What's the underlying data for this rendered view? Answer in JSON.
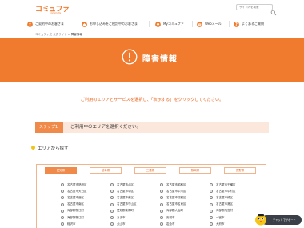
{
  "header": {
    "logo_main": "コミュファ",
    "logo_sub": "commufa",
    "search_placeholder": "サイト内を検索"
  },
  "nav": {
    "items": [
      {
        "label": "ご契約中のお客さま",
        "icon": "user-icon"
      },
      {
        "label": "お申し込みをご検討中のお客さま",
        "icon": "house-icon"
      },
      {
        "label": "Myコミュファ",
        "icon": "heart-icon"
      },
      {
        "label": "Webメール",
        "icon": "mail-icon"
      },
      {
        "label": "よくあるご質問",
        "icon": "question-icon"
      }
    ]
  },
  "breadcrumb": {
    "home": "コミュファ光 公式サイト",
    "separator": ">",
    "current": "障害情報"
  },
  "banner": {
    "title": "障害情報",
    "icon": "exclamation-circle-icon"
  },
  "instruction": "ご利用のエリアとサービスを選択し、「表示する」をクリックしてください。",
  "step": {
    "badge": "ステップ1",
    "text": "ご利用中のエリアを選択ください。"
  },
  "area": {
    "heading": "エリアから探す",
    "tabs": [
      {
        "label": "愛知県",
        "active": true
      },
      {
        "label": "岐阜県",
        "active": false
      },
      {
        "label": "三重県",
        "active": false
      },
      {
        "label": "静岡県",
        "active": false
      },
      {
        "label": "長野県",
        "active": false
      }
    ],
    "cities": [
      [
        "名古屋市熱田区",
        "名古屋市北区",
        "名古屋市昭和区",
        "名古屋市千種区"
      ],
      [
        "名古屋市天白区",
        "名古屋市中区",
        "名古屋市中川区",
        "名古屋市中村区"
      ],
      [
        "名古屋市西区",
        "名古屋市東区",
        "名古屋市瑞穂区",
        "名古屋市緑区"
      ],
      [
        "名古屋市南区",
        "名古屋市守山区",
        "名古屋市名東区",
        "名古屋市港区"
      ],
      [
        "海部郡蟹江町",
        "愛知郡東郷町",
        "海部郡大治町",
        "海部郡飛島村"
      ],
      [
        "海部郡蟹江町",
        "あま市",
        "安城市",
        "一宮市"
      ],
      [
        "稲沢市",
        "犬山市",
        "岩倉市",
        "大府市"
      ]
    ]
  },
  "chat": {
    "label": "チャットでサポート",
    "icon": "bird-mascot-icon"
  },
  "colors": {
    "brand_orange": "#f07a2e",
    "banner": "#f07a2e",
    "step_bg": "#fbe7db",
    "accent_text": "#e8621a"
  }
}
